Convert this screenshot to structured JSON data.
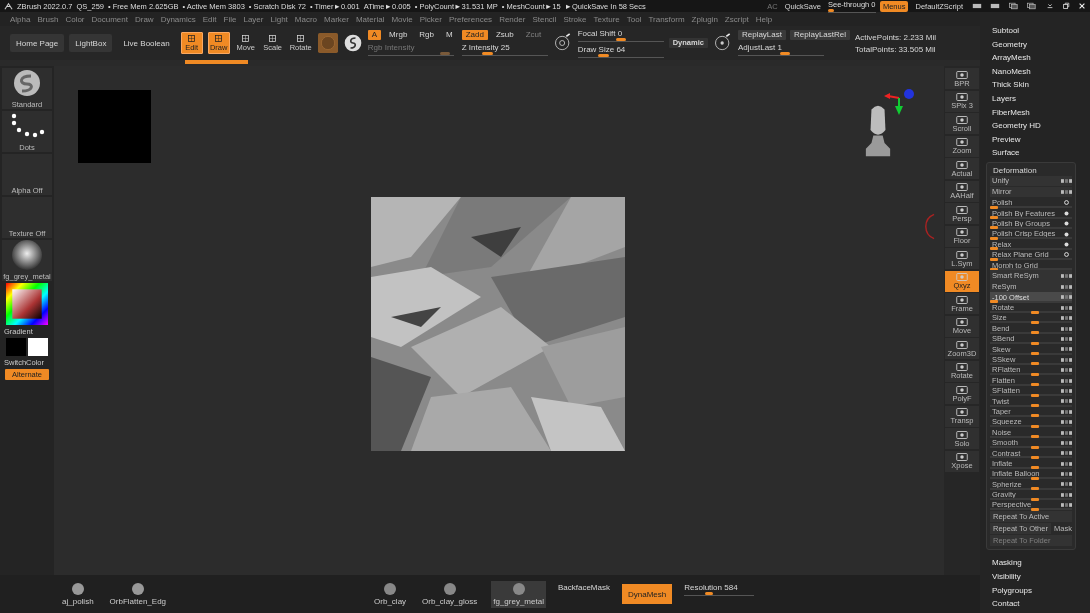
{
  "title_bar": {
    "app": "ZBrush 2022.0.7",
    "file": "QS_259",
    "stats": [
      "• Free Mem 2.625GB",
      "• Active Mem 3803",
      "• Scratch Disk 72",
      "• Timer►0.001",
      "ATime►0.005",
      "• PolyCount►31.531 MP",
      "• MeshCount►15",
      "►QuickSave In 58 Secs"
    ],
    "ac": "AC",
    "quicksave": "QuickSave",
    "see_through": {
      "label": "See-through",
      "value": "0",
      "level": 0.06
    },
    "menus": {
      "label": "Menus",
      "on": true
    },
    "script": "DefaultZScript"
  },
  "menu_bar": [
    "Alpha",
    "Brush",
    "Color",
    "Document",
    "Draw",
    "Dynamics",
    "Edit",
    "File",
    "Layer",
    "Light",
    "Macro",
    "Marker",
    "Material",
    "Movie",
    "Picker",
    "Preferences",
    "Render",
    "Stencil",
    "Stroke",
    "Texture",
    "Tool",
    "Transform",
    "Zplugin",
    "Zscript",
    "Help"
  ],
  "toolbar": {
    "nav_buttons": [
      "Home Page",
      "LightBox",
      "Live Boolean"
    ],
    "modes": [
      {
        "label": "Edit",
        "on": true
      },
      {
        "label": "Draw",
        "on": true
      },
      {
        "label": "Move",
        "on": false
      },
      {
        "label": "Scale",
        "on": false
      },
      {
        "label": "Rotate",
        "on": false
      }
    ],
    "channels": [
      {
        "label": "A",
        "on": true
      },
      {
        "label": "Mrgb",
        "on": false
      },
      {
        "label": "Rgb",
        "on": false
      },
      {
        "label": "M",
        "on": false
      }
    ],
    "rgb_intensity": {
      "label": "Rgb Intensity",
      "level": 0.9
    },
    "z_modes": [
      {
        "label": "Zadd",
        "on": true,
        "disabled": false
      },
      {
        "label": "Zsub",
        "on": false,
        "disabled": false
      },
      {
        "label": "Zcut",
        "on": false,
        "disabled": true
      }
    ],
    "z_intensity": {
      "label": "Z Intensity",
      "value": "25",
      "level": 0.3
    },
    "focal_shift": {
      "label": "Focal Shift",
      "value": "0",
      "level": 0.5
    },
    "draw_size": {
      "label": "Draw Size",
      "value": "64",
      "level": 0.3
    },
    "dynamic": "Dynamic",
    "replay": [
      "ReplayLast",
      "ReplayLastRel"
    ],
    "adjust_last": {
      "label": "AdjustLast",
      "value": "1",
      "level": 0.55
    },
    "active_points": "ActivePoints: 2.233 Mil",
    "total_points": "TotalPoints: 33.505 Mil"
  },
  "left_shelf": {
    "thumbs": [
      {
        "label": "Standard",
        "kind": "brush"
      },
      {
        "label": "Dots",
        "kind": "stroke"
      },
      {
        "label": "Alpha Off",
        "kind": "empty"
      },
      {
        "label": "Texture Off",
        "kind": "empty"
      },
      {
        "label": "fg_grey_metal",
        "kind": "material"
      }
    ],
    "gradient": "Gradient",
    "switch_color": "SwitchColor",
    "alternate": {
      "label": "Alternate",
      "on": true
    }
  },
  "right_tools": [
    {
      "label": "BPR",
      "active": false
    },
    {
      "label": "SPix 3",
      "active": false
    },
    {
      "label": "Scroll",
      "active": false
    },
    {
      "label": "Zoom",
      "active": false
    },
    {
      "label": "Actual",
      "active": false
    },
    {
      "label": "AAHalf",
      "active": false
    },
    {
      "label": "Persp",
      "active": false
    },
    {
      "label": "Floor",
      "active": false
    },
    {
      "label": "L.Sym",
      "active": false
    },
    {
      "label": "Qxyz",
      "active": true
    },
    {
      "label": "Frame",
      "active": false
    },
    {
      "label": "Move",
      "active": false
    },
    {
      "label": "Zoom3D",
      "active": false
    },
    {
      "label": "Rotate",
      "active": false
    },
    {
      "label": "PolyF",
      "active": false
    },
    {
      "label": "Transp",
      "active": false
    },
    {
      "label": "Solo",
      "active": false
    },
    {
      "label": "Xpose",
      "active": false
    }
  ],
  "bottom_shelf": {
    "brushes": [
      {
        "label": "aj_polish",
        "selected": false
      },
      {
        "label": "OrbFlatten_Edg",
        "selected": false
      }
    ],
    "materials": [
      {
        "label": "Orb_clay",
        "selected": false
      },
      {
        "label": "Orb_clay_gloss",
        "selected": false
      },
      {
        "label": "fg_grey_metal",
        "selected": true
      }
    ],
    "backface_mask": "BackfaceMask",
    "dynamesh": {
      "label": "DynaMesh",
      "on": true
    },
    "resolution": {
      "label": "Resolution",
      "value": "584",
      "level": 0.35
    }
  },
  "right_panel": {
    "sections_top": [
      "Subtool",
      "Geometry",
      "ArrayMesh",
      "NanoMesh",
      "Thick Skin",
      "Layers",
      "FiberMesh",
      "Geometry HD",
      "Preview",
      "Surface"
    ],
    "deformation": {
      "title": "Deformation",
      "rows": [
        {
          "label": "Unify",
          "kind": "toggle",
          "selected": false
        },
        {
          "label": "Mirror",
          "kind": "toggle",
          "selected": false
        },
        {
          "label": "Polish",
          "kind": "ring",
          "level": 0.05,
          "selected": false
        },
        {
          "label": "Polish By Features",
          "kind": "dot",
          "level": 0.05,
          "selected": false
        },
        {
          "label": "Polish By Groups",
          "kind": "dot",
          "level": 0.05,
          "selected": false
        },
        {
          "label": "Polish Crisp Edges",
          "kind": "dot",
          "level": 0.05,
          "selected": false
        },
        {
          "label": "Relax",
          "kind": "dot",
          "level": 0.05,
          "selected": false
        },
        {
          "label": "Relax Plane Grid",
          "kind": "ring",
          "level": 0.05,
          "selected": false
        },
        {
          "label": "Morph to Grid",
          "kind": "bare",
          "level": 0.05,
          "selected": false
        },
        {
          "label": "Smart ReSym",
          "kind": "toggle",
          "selected": false
        },
        {
          "label": "ReSym",
          "kind": "toggle",
          "selected": false
        },
        {
          "label": "-100 Offset",
          "kind": "slider",
          "level": 0.05,
          "selected": true
        },
        {
          "label": "Rotate",
          "kind": "slider",
          "level": 0.55,
          "selected": false
        },
        {
          "label": "Size",
          "kind": "slider",
          "level": 0.55,
          "selected": false
        },
        {
          "label": "Bend",
          "kind": "slider",
          "level": 0.55,
          "selected": false
        },
        {
          "label": "SBend",
          "kind": "slider",
          "level": 0.55,
          "selected": false
        },
        {
          "label": "Skew",
          "kind": "slider",
          "level": 0.55,
          "selected": false
        },
        {
          "label": "SSkew",
          "kind": "slider",
          "level": 0.55,
          "selected": false
        },
        {
          "label": "RFlatten",
          "kind": "slider",
          "level": 0.55,
          "selected": false
        },
        {
          "label": "Flatten",
          "kind": "slider",
          "level": 0.55,
          "selected": false
        },
        {
          "label": "SFlatten",
          "kind": "slider",
          "level": 0.55,
          "selected": false
        },
        {
          "label": "Twist",
          "kind": "slider",
          "level": 0.55,
          "selected": false
        },
        {
          "label": "Taper",
          "kind": "slider",
          "level": 0.55,
          "selected": false
        },
        {
          "label": "Squeeze",
          "kind": "slider",
          "level": 0.55,
          "selected": false
        },
        {
          "label": "Noise",
          "kind": "slider",
          "level": 0.55,
          "selected": false
        },
        {
          "label": "Smooth",
          "kind": "slider",
          "level": 0.55,
          "selected": false
        },
        {
          "label": "Contrast",
          "kind": "slider",
          "level": 0.55,
          "selected": false
        },
        {
          "label": "Inflate",
          "kind": "slider",
          "level": 0.55,
          "selected": false
        },
        {
          "label": "Inflate Balloon",
          "kind": "slider",
          "level": 0.55,
          "selected": false
        },
        {
          "label": "Spherize",
          "kind": "slider",
          "level": 0.55,
          "selected": false
        },
        {
          "label": "Gravity",
          "kind": "slider",
          "level": 0.55,
          "selected": false
        },
        {
          "label": "Perspective",
          "kind": "slider",
          "level": 0.55,
          "selected": false
        }
      ],
      "repeat_active": "Repeat To Active",
      "repeat_other": "Repeat To Other",
      "mask": "Mask",
      "repeat_folder": {
        "label": "Repeat To Folder",
        "disabled": true
      }
    },
    "sections_bottom": [
      "Masking",
      "Visibility",
      "Polygroups",
      "Contact"
    ]
  }
}
